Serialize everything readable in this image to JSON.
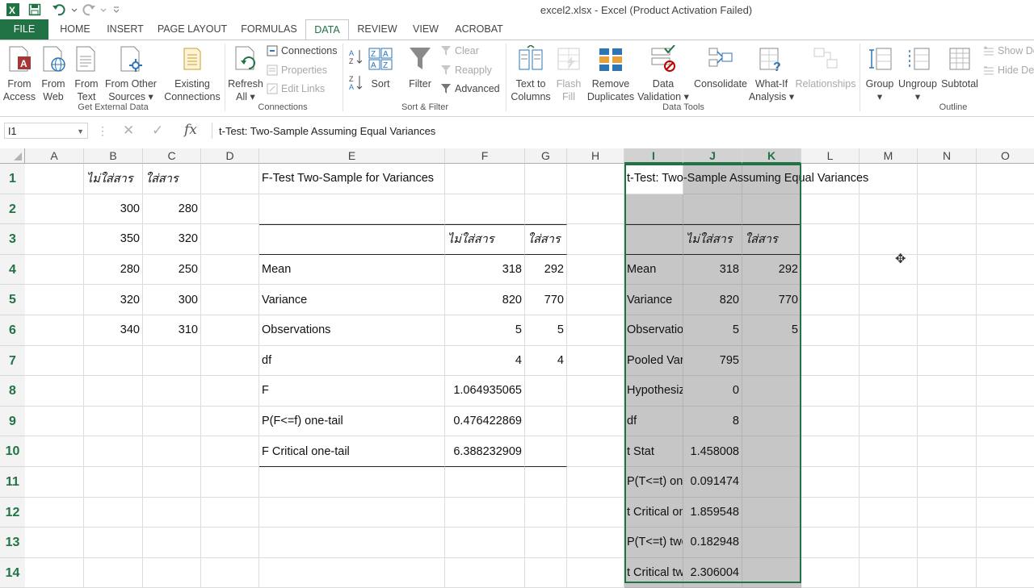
{
  "window": {
    "title": "excel2.xlsx - Excel (Product Activation Failed)"
  },
  "tabs": [
    "FILE",
    "HOME",
    "INSERT",
    "PAGE LAYOUT",
    "FORMULAS",
    "DATA",
    "REVIEW",
    "VIEW",
    "ACROBAT"
  ],
  "active_tab": "DATA",
  "ribbon": {
    "from_access": [
      "From",
      "Access"
    ],
    "from_web": [
      "From",
      "Web"
    ],
    "from_text": [
      "From",
      "Text"
    ],
    "from_other": [
      "From Other",
      "Sources ▾"
    ],
    "existing_conn": [
      "Existing",
      "Connections"
    ],
    "group_get_external": "Get External Data",
    "refresh_all": [
      "Refresh",
      "All ▾"
    ],
    "connections": "Connections",
    "properties": "Properties",
    "edit_links": "Edit Links",
    "group_connections": "Connections",
    "sort": "Sort",
    "filter": "Filter",
    "clear": "Clear",
    "reapply": "Reapply",
    "advanced": "Advanced",
    "group_sort_filter": "Sort & Filter",
    "text_to_columns": [
      "Text to",
      "Columns"
    ],
    "flash_fill": [
      "Flash",
      "Fill"
    ],
    "remove_duplicates": [
      "Remove",
      "Duplicates"
    ],
    "data_validation": [
      "Data",
      "Validation ▾"
    ],
    "consolidate": "Consolidate",
    "what_if": [
      "What-If",
      "Analysis ▾"
    ],
    "relationships": "Relationships",
    "group_data_tools": "Data Tools",
    "group": [
      "Group",
      "▾"
    ],
    "ungroup": [
      "Ungroup",
      "▾"
    ],
    "subtotal": "Subtotal",
    "show_detail": "Show De",
    "hide_detail": "Hide De",
    "group_outline": "Outline"
  },
  "formula_bar": {
    "name_box": "I1",
    "formula": "t-Test: Two-Sample Assuming Equal Variances"
  },
  "columns": [
    "A",
    "B",
    "C",
    "D",
    "E",
    "F",
    "G",
    "H",
    "I",
    "J",
    "K",
    "L",
    "M",
    "N",
    "O"
  ],
  "rows": [
    "1",
    "2",
    "3",
    "4",
    "5",
    "6",
    "7",
    "8",
    "9",
    "10",
    "11",
    "12",
    "13",
    "14"
  ],
  "cells": {
    "B1": "ไม่ใส่สาร",
    "C1": "ใส่สาร",
    "B2": "300",
    "C2": "280",
    "B3": "350",
    "C3": "320",
    "B4": "280",
    "C4": "250",
    "B5": "320",
    "C5": "300",
    "B6": "340",
    "C6": "310",
    "E1": "F-Test Two-Sample for Variances",
    "F3": "ไม่ใส่สาร",
    "G3": "ใส่สาร",
    "E4": "Mean",
    "F4": "318",
    "G4": "292",
    "E5": "Variance",
    "F5": "820",
    "G5": "770",
    "E6": "Observations",
    "F6": "5",
    "G6": "5",
    "E7": "df",
    "F7": "4",
    "G7": "4",
    "E8": "F",
    "F8": "1.064935065",
    "E9": "P(F<=f) one-tail",
    "F9": "0.476422869",
    "E10": "F Critical one-tail",
    "F10": "6.388232909",
    "I1": "t-Test: Two-Sample Assuming Equal Variances",
    "J3": "ไม่ใส่สาร",
    "K3": "ใส่สาร",
    "I4": "Mean",
    "J4": "318",
    "K4": "292",
    "I5": "Variance",
    "J5": "820",
    "K5": "770",
    "I6": "Observations",
    "J6": "5",
    "K6": "5",
    "I7": "Pooled Variance",
    "J7": "795",
    "I8": "Hypothesized Mean Difference",
    "J8": "0",
    "I9": "df",
    "J9": "8",
    "I10": "t Stat",
    "J10": "1.458008",
    "I11": "P(T<=t) one-tail",
    "J11": "0.091474",
    "I12": "t Critical one-tail",
    "J12": "1.859548",
    "I13": "P(T<=t) two-tail",
    "J13": "0.182948",
    "I14": "t Critical two-tail",
    "J14": "2.306004"
  },
  "colors": {
    "excel_green": "#217346",
    "selection_gray": "#c6c6c6"
  }
}
